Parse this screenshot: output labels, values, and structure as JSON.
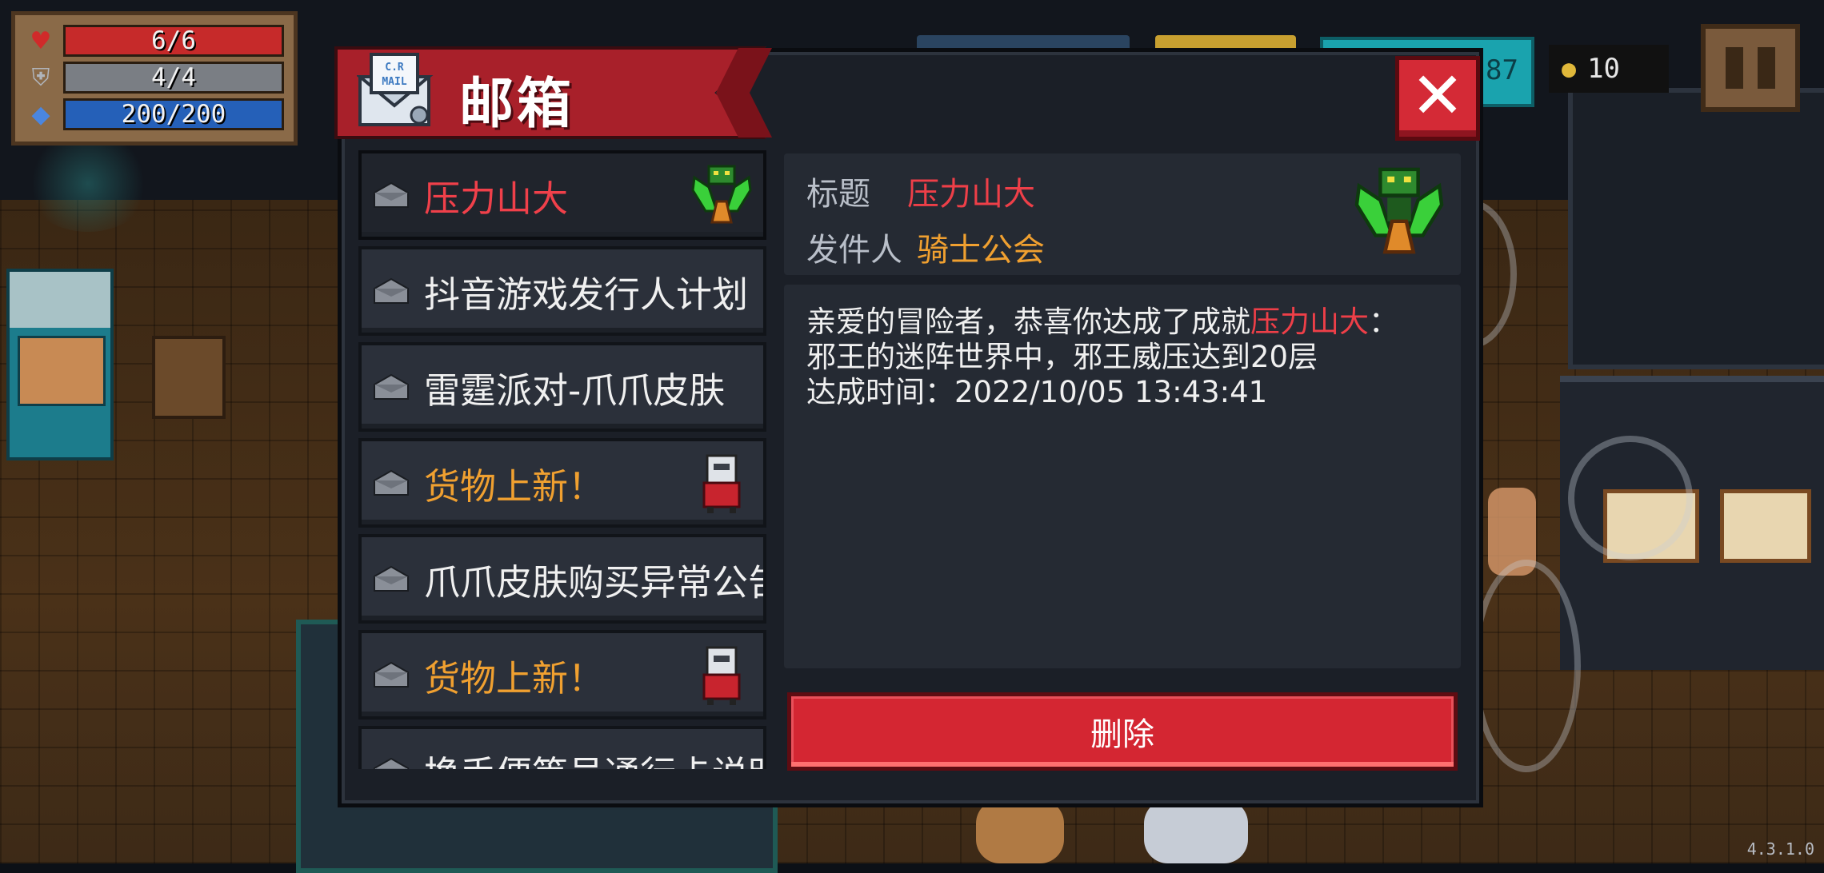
{
  "hud": {
    "hp": "6/6",
    "shield": "4/4",
    "energy": "200/200",
    "gems": "87",
    "coins": "10",
    "version": "4.3.1.0",
    "icons": {
      "hp": "heart-icon",
      "shield": "shield-icon",
      "energy": "energy-diamond-icon",
      "coin": "coin-icon",
      "pause": "pause-icon"
    }
  },
  "mailbox": {
    "title": "邮箱",
    "icon_text": "C.R MAIL",
    "close_label": "✕",
    "list": [
      {
        "label": "压力山大",
        "color": "red",
        "thumb": "green-boss-icon"
      },
      {
        "label": "抖音游戏发行人计划",
        "color": "white",
        "thumb": ""
      },
      {
        "label": "雷霆派对-爪爪皮肤",
        "color": "white",
        "thumb": ""
      },
      {
        "label": "货物上新！",
        "color": "orange",
        "thumb": "merchant-icon"
      },
      {
        "label": "爪爪皮肤购买异常公告",
        "color": "white",
        "thumb": ""
      },
      {
        "label": "货物上新！",
        "color": "orange",
        "thumb": "merchant-icon"
      },
      {
        "label": "换手便等号通行卡说明",
        "color": "white",
        "thumb": ""
      }
    ],
    "detail": {
      "title_key": "标题",
      "title_value": "压力山大",
      "sender_key": "发件人",
      "sender_value": "骑士公会",
      "body_line1_prefix": "亲爱的冒险者，恭喜你达成了成就",
      "body_line1_highlight": "压力山大",
      "body_line1_suffix": "：",
      "body_line2": "邪王的迷阵世界中，邪王威压达到20层",
      "body_line3": "达成时间：2022/10/05 13:43:41"
    },
    "delete_label": "删除"
  },
  "colors": {
    "accent_red": "#d42632",
    "title_red": "#ee3f48",
    "orange": "#f0a030",
    "panel": "#1b1f27"
  }
}
